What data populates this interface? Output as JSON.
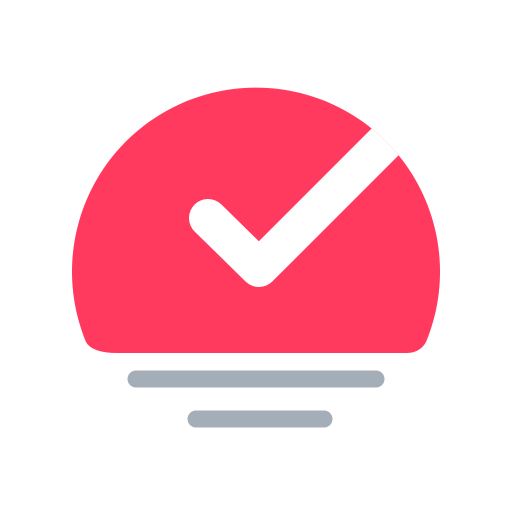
{
  "logo": {
    "name": "checkmark-sunrise-logo",
    "colors": {
      "dome": "#FF3A5E",
      "check": "#FFFFFF",
      "lines": "#A4AEB8",
      "background": "#FFFFFF"
    }
  }
}
